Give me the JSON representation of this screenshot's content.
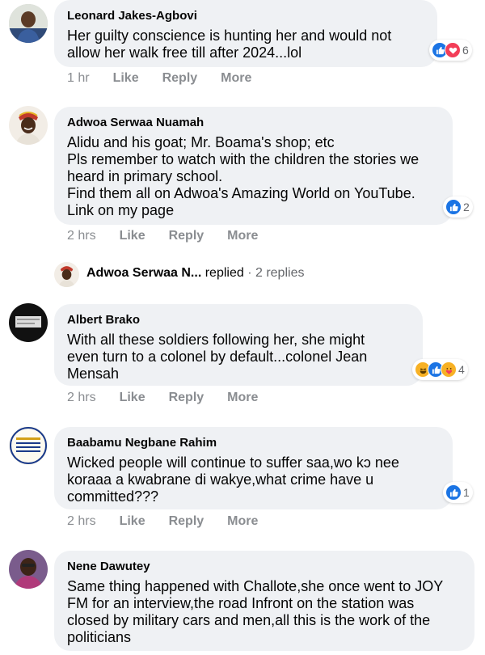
{
  "comments": [
    {
      "author": "Leonard Jakes-Agbovi",
      "lines": [
        "Her guilty conscience is hunting her and would not",
        "allow her walk free till after 2024...lol"
      ],
      "time": "1 hr",
      "like": "Like",
      "reply": "Reply",
      "more": "More",
      "reaction_count": "6",
      "reactions": [
        "like-icon",
        "love-icon"
      ]
    },
    {
      "author": "Adwoa Serwaa Nuamah",
      "lines": [
        "Alidu and his goat; Mr. Boama's shop; etc",
        "Pls remember to watch with the children the stories we",
        "heard in primary school.",
        "Find them all on Adwoa's Amazing World on YouTube.",
        "Link on my page"
      ],
      "time": "2 hrs",
      "like": "Like",
      "reply": "Reply",
      "more": "More",
      "reaction_count": "2",
      "reactions": [
        "like-icon"
      ]
    },
    {
      "author": "Albert Brako",
      "lines": [
        "With all these soldiers following her, she might",
        "even turn to a colonel by default...colonel Jean",
        "Mensah"
      ],
      "time": "2 hrs",
      "like": "Like",
      "reply": "Reply",
      "more": "More",
      "reaction_count": "4",
      "reactions": [
        "haha-icon",
        "like-icon",
        "care-icon"
      ]
    },
    {
      "author": "Baabamu Negbane Rahim",
      "lines": [
        "Wicked people will continue to suffer saa,wo kɔ nee",
        "koraaa a kwabrane di wakye,what crime have u",
        "committed???"
      ],
      "time": "2 hrs",
      "like": "Like",
      "reply": "Reply",
      "more": "More",
      "reaction_count": "1",
      "reactions": [
        "like-icon"
      ]
    },
    {
      "author": "Nene Dawutey",
      "lines": [
        "Same thing happened with Challote,she once went to JOY",
        "FM for an interview,the road Infront on the station was",
        "closed by military cars and men,all this is the work of the",
        "politicians"
      ]
    }
  ],
  "reply_summary": {
    "name": "Adwoa Serwaa N...",
    "verb": "replied",
    "sep": "·",
    "count": "2 replies"
  },
  "colors": {
    "bubble": "#eff1f4",
    "like_blue": "#1b74e4",
    "love_red": "#f33e58",
    "haha_yellow": "#f7b125",
    "muted": "#8a8d91"
  }
}
